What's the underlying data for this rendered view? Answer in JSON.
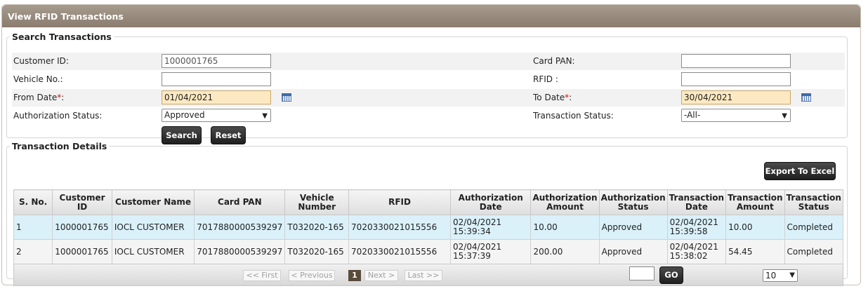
{
  "header": {
    "title": "View RFID Transactions"
  },
  "search": {
    "legend": "Search Transactions",
    "customer_id_label": "Customer ID:",
    "customer_id_value": "1000001765",
    "card_pan_label": "Card PAN:",
    "card_pan_value": "",
    "vehicle_label": "Vehicle No.:",
    "vehicle_value": "",
    "rfid_label": "RFID :",
    "rfid_value": "",
    "from_date_label": "From Date",
    "from_date_value": "01/04/2021",
    "to_date_label": "To Date",
    "to_date_value": "30/04/2021",
    "required_mark": "*",
    "colon": ":",
    "auth_status_label": "Authorization Status:",
    "auth_status_value": "Approved",
    "txn_status_label": "Transaction Status:",
    "txn_status_value": "-All-",
    "search_button": "Search",
    "reset_button": "Reset",
    "dropdown_icon": "chevron-down-icon",
    "calendar_icon": "calendar-icon"
  },
  "details": {
    "legend": "Transaction Details",
    "export_button": "Export To Excel",
    "columns": [
      "S. No.",
      "Customer ID",
      "Customer Name",
      "Card PAN",
      "Vehicle Number",
      "RFID",
      "Authorization Date",
      "Authorization Amount",
      "Authorization Status",
      "Transaction Date",
      "Transaction Amount",
      "Transaction Status"
    ],
    "rows": [
      [
        "1",
        "1000001765",
        "IOCL CUSTOMER",
        "7017880000539297",
        "T032020-165",
        "7020330021015556",
        "02/04/2021 15:39:34",
        "10.00",
        "Approved",
        "02/04/2021 15:39:58",
        "10.00",
        "Completed"
      ],
      [
        "2",
        "1000001765",
        "IOCL CUSTOMER",
        "7017880000539297",
        "T032020-165",
        "7020330021015556",
        "02/04/2021 15:37:39",
        "200.00",
        "Approved",
        "02/04/2021 15:38:02",
        "54.45",
        "Completed"
      ]
    ],
    "pager": {
      "first": "<< First",
      "previous": "< Previous",
      "current_page": "1",
      "next": "Next >",
      "last": "Last >>",
      "go_value": "",
      "go_button": "GO",
      "page_size": "10"
    }
  },
  "colors": {
    "header_bg": "#8a7c6d",
    "date_field_bg": "#fde9c1",
    "selected_row_bg": "#daf1fa",
    "current_page_bg": "#5a4a3a",
    "required_mark": "#d01010"
  }
}
